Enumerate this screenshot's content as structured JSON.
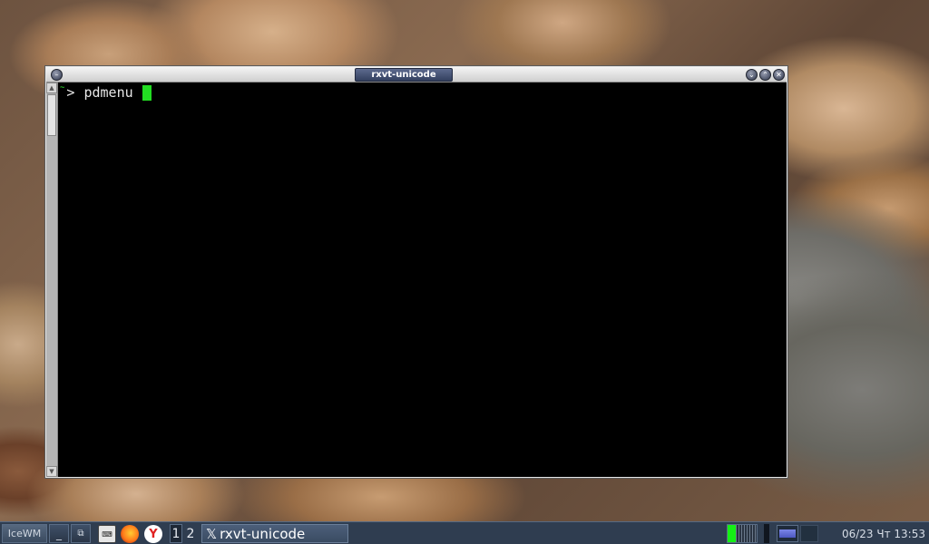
{
  "window": {
    "title": "rxvt-unicode",
    "buttons": {
      "menu": "–",
      "minimize": "⌄",
      "maximize": "⌃",
      "close": "✕"
    }
  },
  "terminal": {
    "prompt_dir": "~",
    "prompt_symbol": ">",
    "command": "pdmenu"
  },
  "taskbar": {
    "start_label": "IceWM",
    "show_desktop": "_",
    "window_list": "⧉",
    "launchers": [
      {
        "icon": "terminal-icon",
        "label": "⌨"
      },
      {
        "icon": "firefox-icon",
        "label": ""
      },
      {
        "icon": "yandex-icon",
        "label": "Y"
      }
    ],
    "workspaces": [
      "1",
      "2"
    ],
    "tasks": [
      {
        "title": "rxvt-unicode",
        "icon": "x-icon"
      }
    ],
    "clock": "06/23 Чт 13:53",
    "cpu_usage": 0.25
  },
  "colors": {
    "terminal_bg": "#000000",
    "cursor": "#22dd22",
    "taskbar_bg": "#2f3d50",
    "title_pill": "#3e4a6d"
  }
}
